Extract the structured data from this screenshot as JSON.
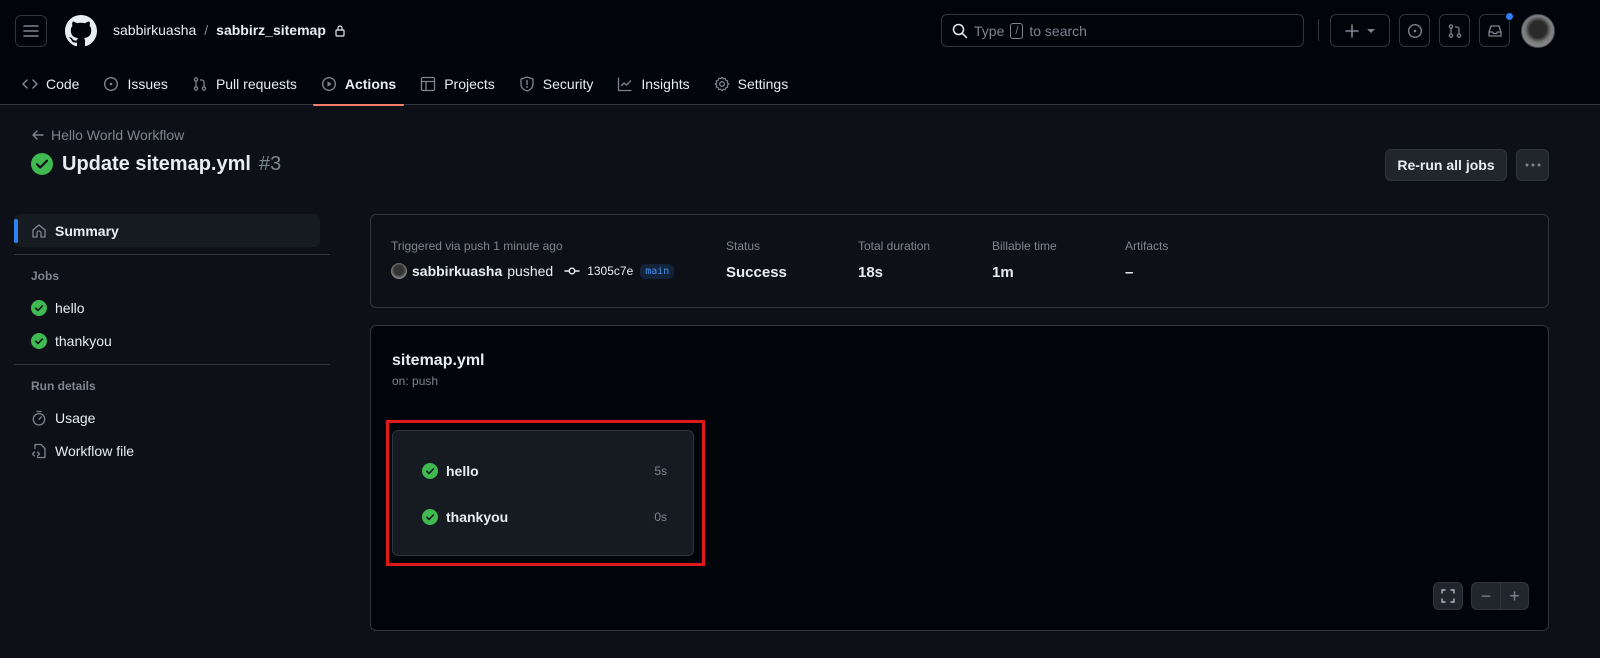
{
  "header": {
    "owner": "sabbirkuasha",
    "separator": "/",
    "repo": "sabbirz_sitemap",
    "search_placeholder_prefix": "Type",
    "search_key": "/",
    "search_placeholder_suffix": "to search",
    "icons": {
      "menu": "hamburger-icon",
      "logo": "github-logo-icon",
      "lock": "lock-icon",
      "search": "search-icon",
      "create": "plus-icon",
      "issues": "issue-opened-icon",
      "pulls": "git-pull-request-icon",
      "inbox": "inbox-icon"
    },
    "notification_dot_color": "#2f81f7"
  },
  "nav": {
    "tabs": [
      {
        "label": "Code",
        "icon": "code-icon",
        "active": false
      },
      {
        "label": "Issues",
        "icon": "issue-opened-icon",
        "active": false
      },
      {
        "label": "Pull requests",
        "icon": "git-pull-request-icon",
        "active": false
      },
      {
        "label": "Actions",
        "icon": "play-icon",
        "active": true
      },
      {
        "label": "Projects",
        "icon": "table-icon",
        "active": false
      },
      {
        "label": "Security",
        "icon": "shield-icon",
        "active": false
      },
      {
        "label": "Insights",
        "icon": "graph-icon",
        "active": false
      },
      {
        "label": "Settings",
        "icon": "gear-icon",
        "active": false
      }
    ],
    "active_underline_color": "#f78166"
  },
  "run": {
    "back_label": "Hello World Workflow",
    "title": "Update sitemap.yml",
    "number": "#3",
    "status_color": "#3fb950",
    "rerun_label": "Re-run all jobs",
    "more_label": "···"
  },
  "sidebar": {
    "summary_label": "Summary",
    "jobs_heading": "Jobs",
    "jobs": [
      {
        "label": "hello",
        "status": "success"
      },
      {
        "label": "thankyou",
        "status": "success"
      }
    ],
    "run_details_heading": "Run details",
    "details": [
      {
        "label": "Usage",
        "icon": "stopwatch-icon"
      },
      {
        "label": "Workflow file",
        "icon": "file-code-icon"
      }
    ]
  },
  "summary": {
    "trigger_label": "Triggered via push 1 minute ago",
    "actor": "sabbirkuasha",
    "action": "pushed",
    "commit": "1305c7e",
    "branch": "main",
    "status_label": "Status",
    "status_value": "Success",
    "duration_label": "Total duration",
    "duration_value": "18s",
    "billable_label": "Billable time",
    "billable_value": "1m",
    "artifacts_label": "Artifacts",
    "artifacts_value": "–"
  },
  "graph": {
    "workflow_file": "sitemap.yml",
    "trigger": "on: push",
    "jobs": [
      {
        "label": "hello",
        "duration": "5s",
        "status": "success"
      },
      {
        "label": "thankyou",
        "duration": "0s",
        "status": "success"
      }
    ],
    "highlight_color": "#e0191b",
    "zoom_out_label": "−",
    "zoom_in_label": "+"
  }
}
